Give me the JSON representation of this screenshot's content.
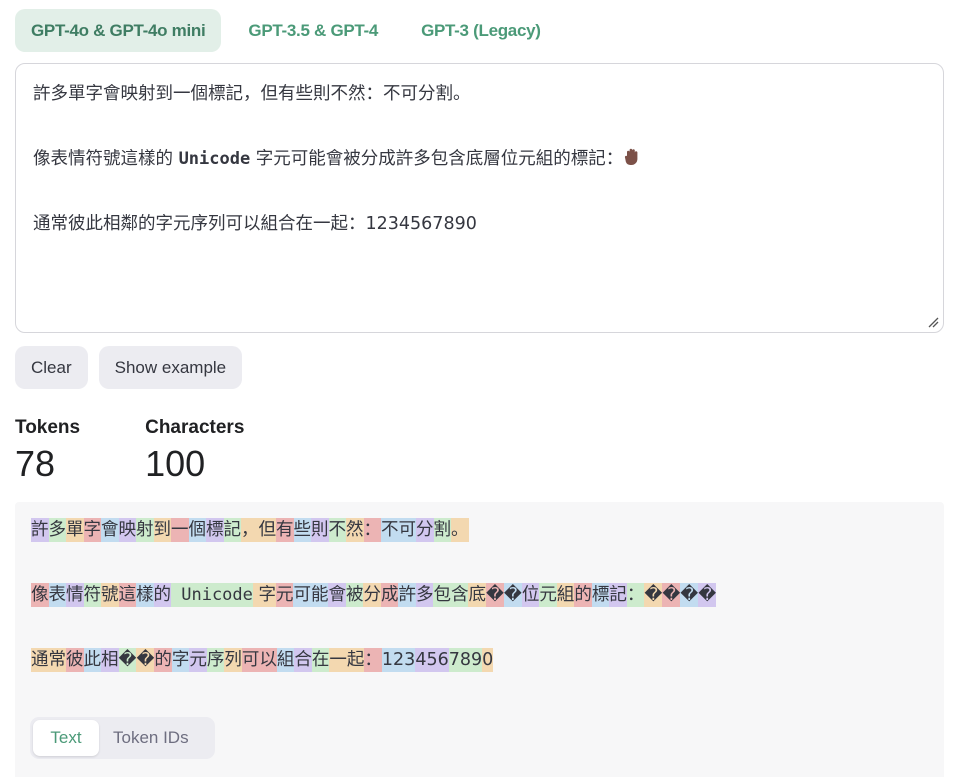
{
  "model_tabs": [
    {
      "label": "GPT-4o & GPT-4o mini",
      "active": true
    },
    {
      "label": "GPT-3.5 & GPT-4",
      "active": false
    },
    {
      "label": "GPT-3 (Legacy)",
      "active": false
    }
  ],
  "input": {
    "line1": "許多單字會映射到一個標記，但有些則不然：不可分割。",
    "line2_pre": "像表情符號這樣的 ",
    "line2_mono": "Unicode",
    "line2_post": " 字元可能會被分成許多包含底層位元組的標記：",
    "line2_emoji": "raised-hand-emoji",
    "line3_pre": "通常彼此相鄰的字元序列可以組合在一起：",
    "line3_num": "1234567890"
  },
  "buttons": {
    "clear": "Clear",
    "show_example": "Show example"
  },
  "stats": {
    "tokens_label": "Tokens",
    "tokens_value": "78",
    "characters_label": "Characters",
    "characters_value": "100"
  },
  "token_colors": [
    "#d2c7ef",
    "#cdebcd",
    "#f3d8b0",
    "#ecb4b4",
    "#c2dcf0"
  ],
  "tokenized_lines": [
    {
      "start_color": 0,
      "tokens": [
        "許",
        "多",
        "單",
        "字",
        "會",
        "映",
        "射",
        "到",
        "一",
        "個",
        "標",
        "記",
        "，但",
        "有",
        "些",
        "則",
        "不",
        "然",
        "：",
        "不可",
        "分",
        "割",
        "。"
      ]
    },
    {
      "start_color": 3,
      "tokens": [
        "像",
        "表",
        "情",
        "符",
        "號",
        "這",
        "樣",
        "的",
        " Unicode",
        " 字",
        "元",
        "可能",
        "會",
        "被",
        "分",
        "成",
        "許",
        "多",
        "包含",
        "底",
        "�",
        "�",
        "位",
        "元",
        "組",
        "的",
        "標",
        "記",
        "：",
        "�",
        "�",
        "�",
        "�"
      ]
    },
    {
      "start_color": 2,
      "tokens": [
        "通常",
        "彼",
        "此",
        "相",
        "�",
        "�",
        "的",
        "字",
        "元",
        "序",
        "列",
        "可以",
        "組",
        "合",
        "在",
        "一起",
        "：",
        "123",
        "456",
        "789",
        "0"
      ]
    }
  ],
  "view_toggle": [
    {
      "label": "Text",
      "active": true
    },
    {
      "label": "Token IDs",
      "active": false
    }
  ]
}
